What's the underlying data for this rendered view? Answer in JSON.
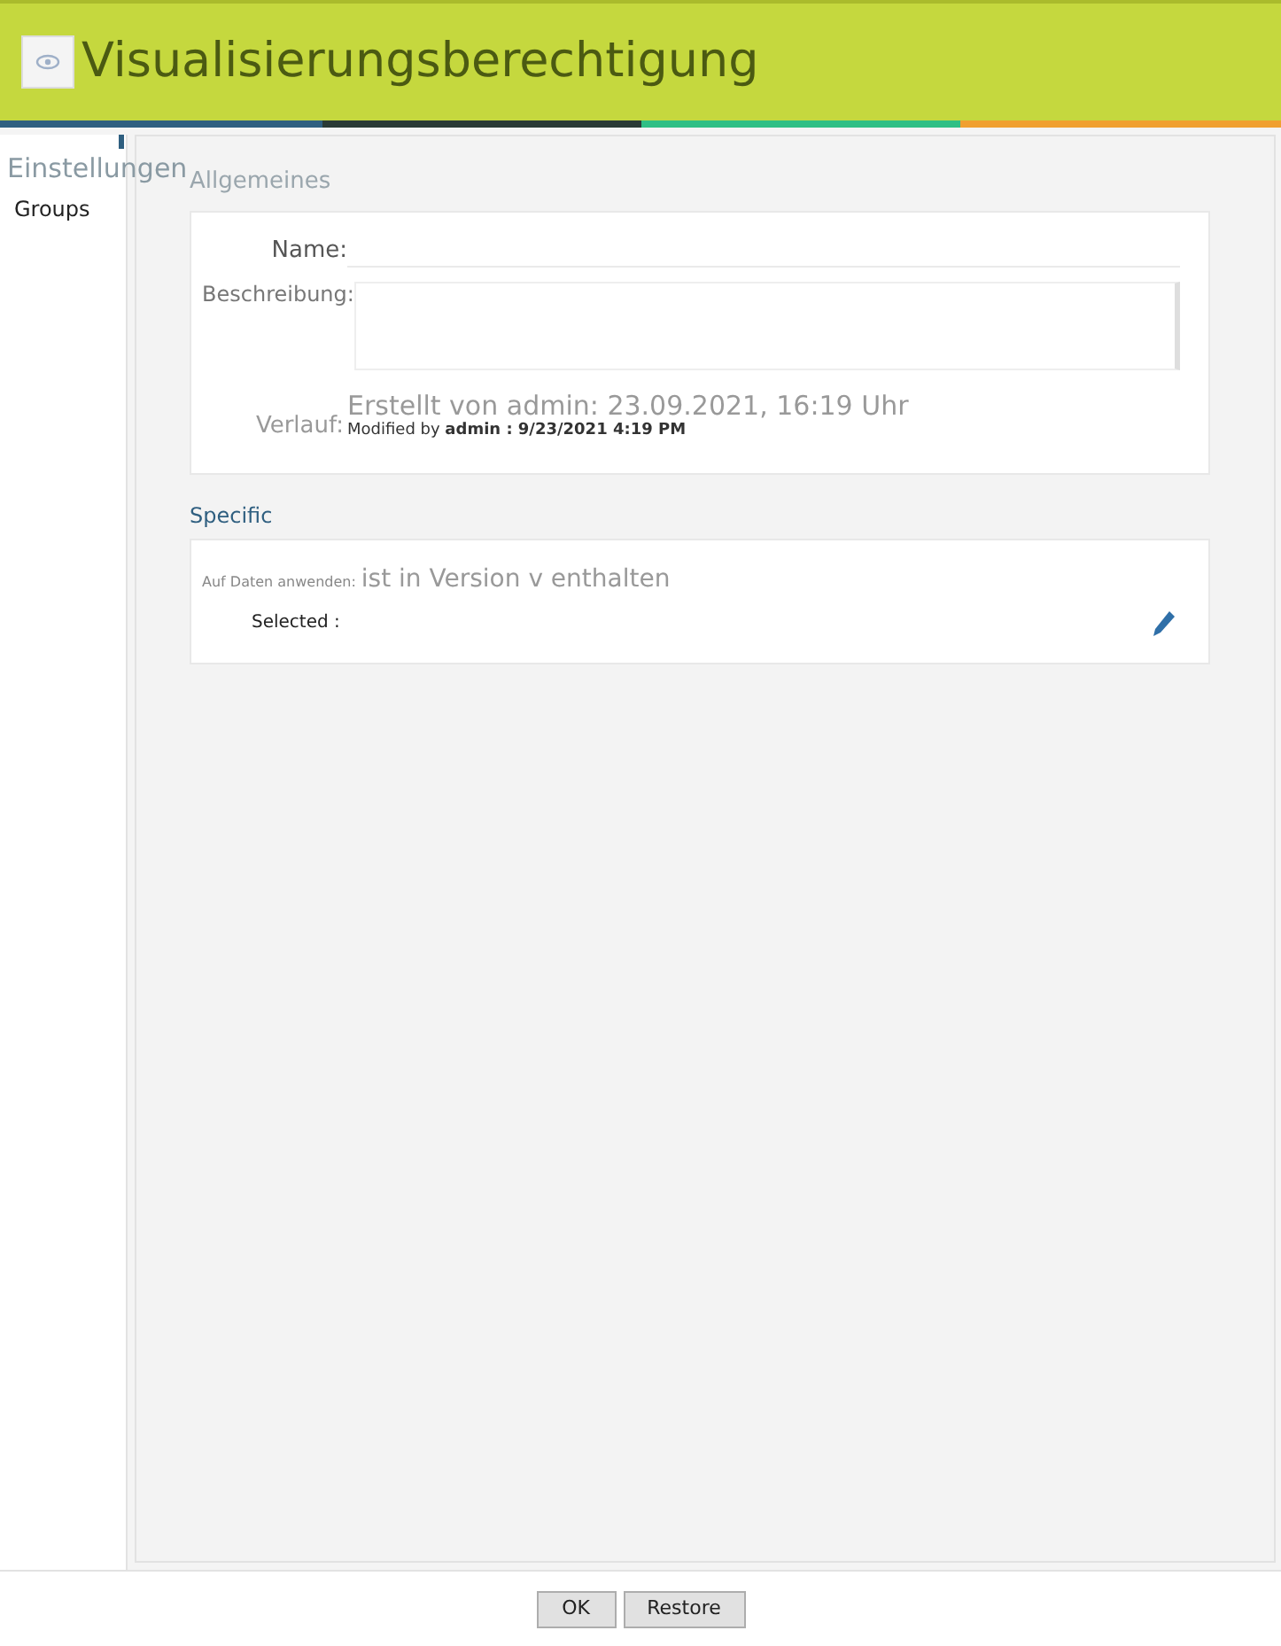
{
  "window": {
    "title": "Visualisierungsberechtigung"
  },
  "sidebar": {
    "title": "Einstellungen",
    "items": [
      {
        "label": "Groups"
      }
    ]
  },
  "general": {
    "title": "Allgemeines",
    "name_label": "Name:",
    "description_label": "Beschreibung:",
    "history_label": "Verlauf:",
    "created": "Erstellt von admin: 23.09.2021, 16:19 Uhr",
    "modified": "Modified by **admin : 9/23/2021 4:19 PM**"
  },
  "specific": {
    "title": "Specific",
    "apply_label": "Auf Daten anwenden:",
    "apply_value": "ist in Version v enthalten",
    "selected_label": "Selected :"
  },
  "buttons": [
    "OK",
    "Restore"
  ]
}
